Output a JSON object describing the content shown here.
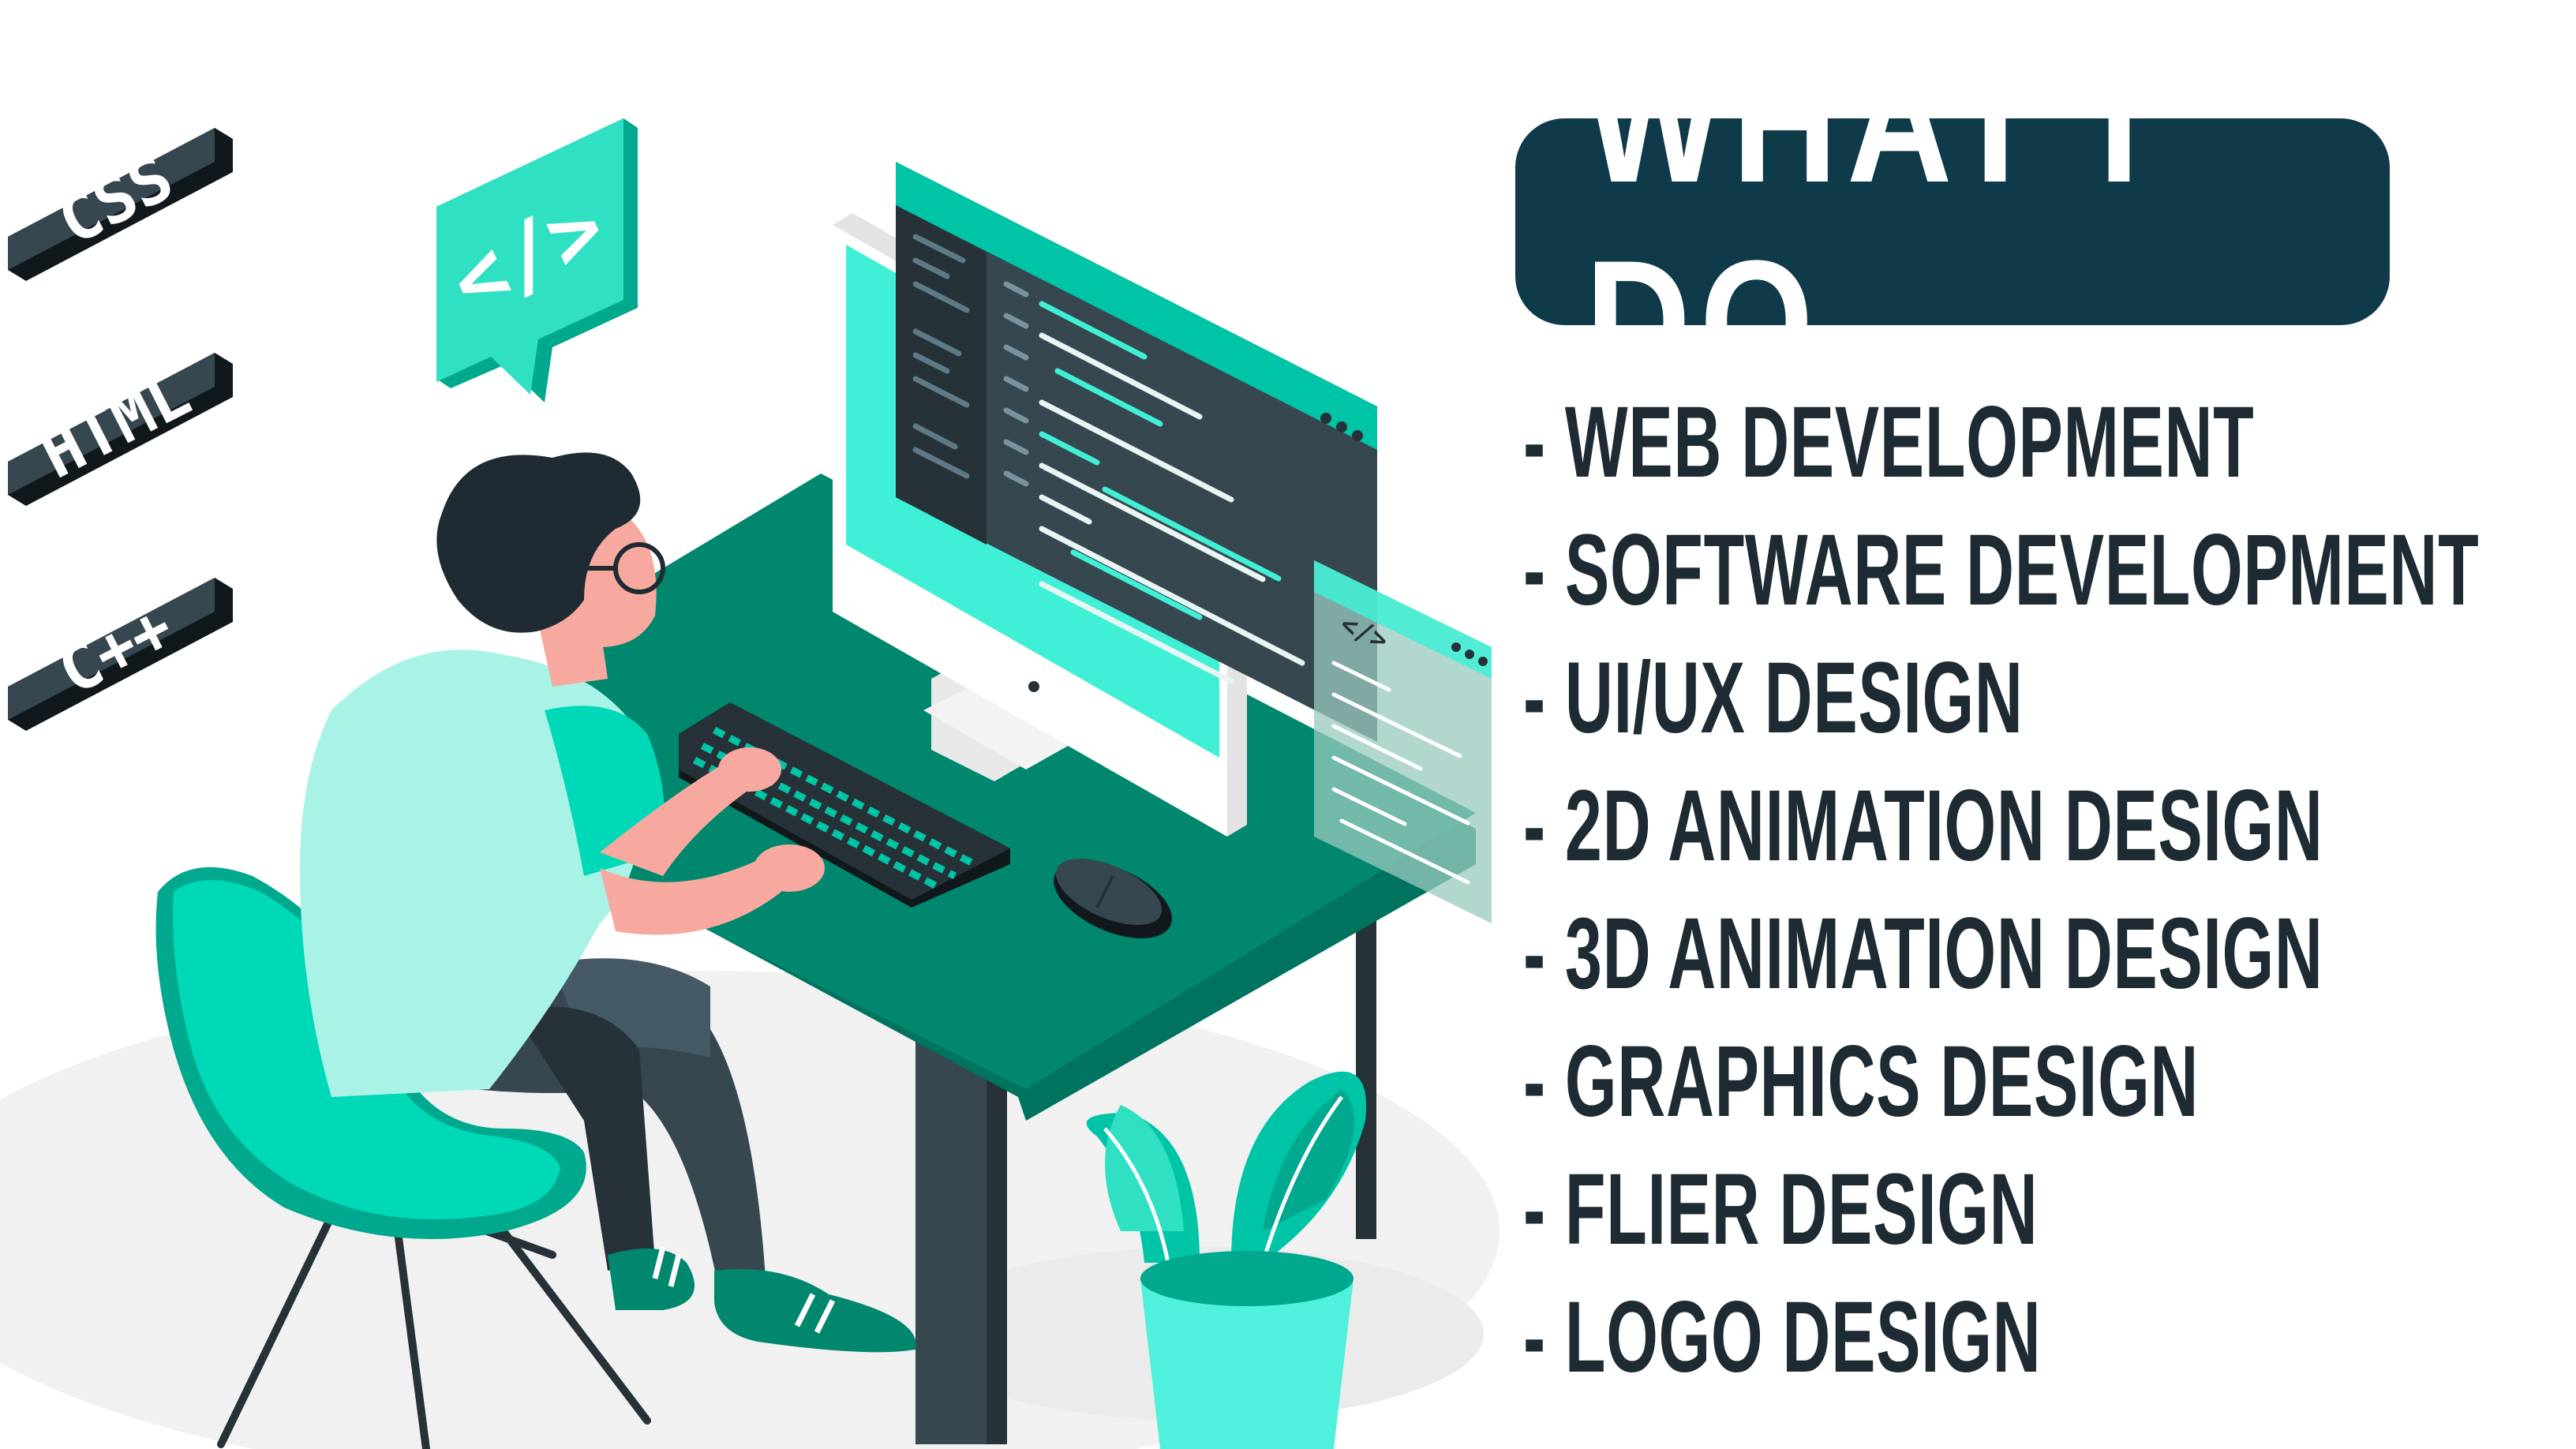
{
  "tech_badges": [
    {
      "label": "CSS"
    },
    {
      "label": "HTML"
    },
    {
      "label": "C++"
    }
  ],
  "code_bubble": {
    "icon": "code-tag-icon",
    "glyph": "</>"
  },
  "window_glyph": "</>",
  "title": "WHAT I DO",
  "services": [
    {
      "label": "- WEB DEVELOPMENT"
    },
    {
      "label": "- SOFTWARE DEVELOPMENT"
    },
    {
      "label": "- UI/UX DESIGN"
    },
    {
      "label": "- 2D ANIMATION DESIGN"
    },
    {
      "label": "- 3D ANIMATION DESIGN"
    },
    {
      "label": "- GRAPHICS DESIGN"
    },
    {
      "label": "- FLIER DESIGN"
    },
    {
      "label": "- LOGO DESIGN"
    }
  ],
  "colors": {
    "accent": "#00d9b8",
    "accent_dark": "#008a72",
    "navy": "#0f3a49",
    "dark": "#263238",
    "skin": "#f7a9a0",
    "text": "#1e2b33"
  }
}
